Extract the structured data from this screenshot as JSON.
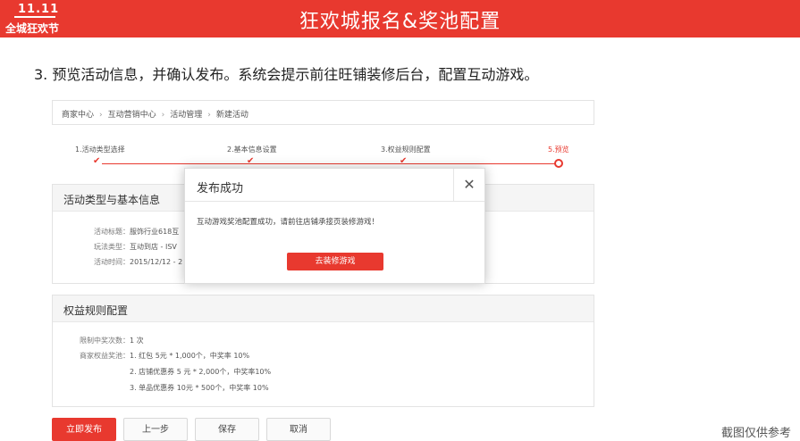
{
  "header": {
    "title": "狂欢城报名&奖池配置",
    "logo_top": "11.11",
    "logo_bottom": "全城狂欢节"
  },
  "instruction": "3. 预览活动信息，并确认发布。系统会提示前往旺铺装修后台，配置互动游戏。",
  "breadcrumb": {
    "items": [
      "商家中心",
      "互动营销中心",
      "活动管理",
      "新建活动"
    ],
    "separator": "›"
  },
  "steps": {
    "items": [
      "1.活动类型选择",
      "2.基本信息设置",
      "3.权益规则配置",
      "5.预览"
    ]
  },
  "basic_panel": {
    "title": "活动类型与基本信息",
    "rows": [
      {
        "key": "活动标题：",
        "value": "服饰行业618互"
      },
      {
        "key": "玩法类型：",
        "value": "互动到店 - ISV"
      },
      {
        "key": "活动时间：",
        "value": "2015/12/12 - 2"
      }
    ]
  },
  "rights_panel": {
    "title": "权益规则配置",
    "rows": [
      {
        "key": "限制中奖次数：",
        "value": "1 次"
      },
      {
        "key": "商家权益奖池：",
        "value": "1. 红包 5元 * 1,000个，中奖率 10%"
      },
      {
        "key": "",
        "value": "2. 店铺优惠券 5 元 * 2,000个，中奖率10%"
      },
      {
        "key": "",
        "value": "3. 单品优惠券  10元 * 500个，中奖率 10%"
      }
    ]
  },
  "modal": {
    "title": "发布成功",
    "close": "✕",
    "message": "互动游戏奖池配置成功，请前往店铺承接页装修游戏！",
    "button": "去装修游戏"
  },
  "buttons": {
    "publish": "立即发布",
    "prev": "上一步",
    "save": "保存",
    "cancel": "取消"
  },
  "note": "截图仅供参考",
  "colors": {
    "accent": "#e8392f"
  }
}
